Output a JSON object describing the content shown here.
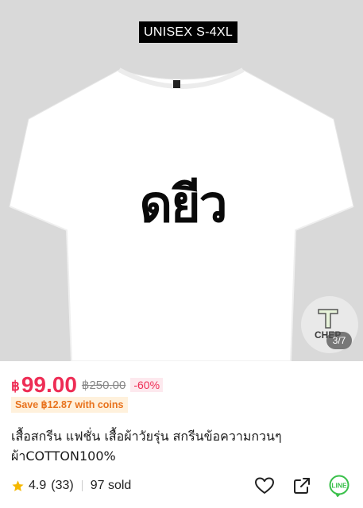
{
  "gallery": {
    "size_badge": "UNISEX S-4XL",
    "print_text": "ดยีว",
    "logo_text": "CHEP",
    "counter": "3/7"
  },
  "product": {
    "currency_symbol": "฿",
    "price": "99.00",
    "original_price": "฿250.00",
    "discount": "-60%",
    "coins_text": "Save ฿12.87 with coins",
    "title_line1": "เสื้อสกรีน แฟชั่น เสื้อผ้าวัยรุ่น สกรีนข้อความกวนๆ",
    "title_line2": "ผ้าCOTTON100%",
    "rating": "4.9",
    "reviews": "(33)",
    "sold": "97 sold"
  },
  "colors": {
    "accent": "#ee2d55",
    "coins_bg": "#fff1dc",
    "coins_text": "#e8721c",
    "line_green": "#3ac04b",
    "star": "#f5b800"
  },
  "icons": {
    "favorite": "heart-icon",
    "share": "share-icon",
    "line": "line-icon",
    "rating": "star-icon"
  }
}
